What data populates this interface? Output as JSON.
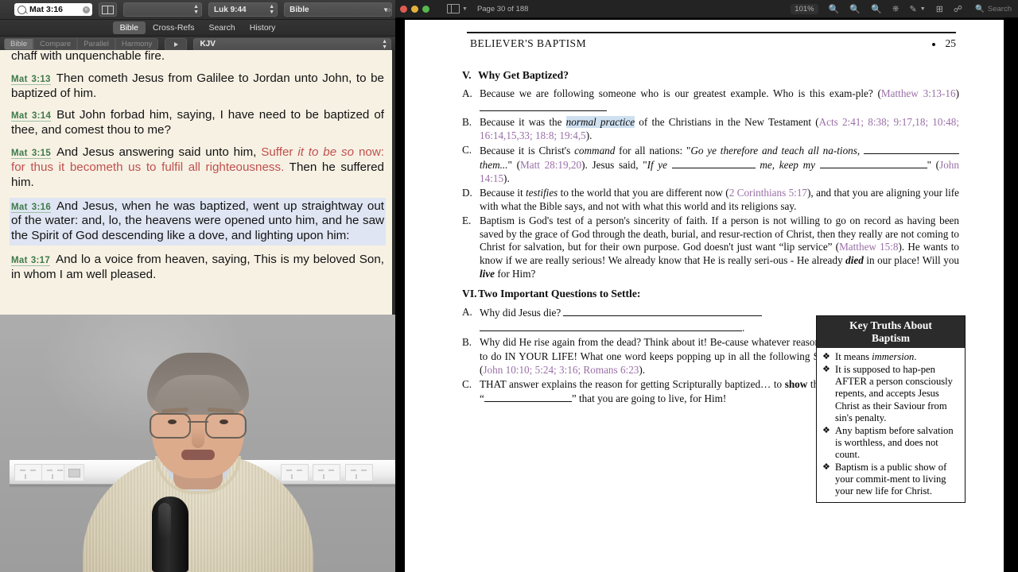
{
  "bible_app": {
    "toolbar": {
      "search_value": "Mat 3:16",
      "clear_icon": "clear-circle-icon",
      "parallel_icon": "two-pane-icon",
      "popup_blank": "",
      "popup_verse": "Luk 9:44",
      "popup_module": "Bible",
      "overflow": "»"
    },
    "tabs": [
      {
        "label": "Bible",
        "active": true
      },
      {
        "label": "Cross-Refs",
        "active": false
      },
      {
        "label": "Search",
        "active": false
      },
      {
        "label": "History",
        "active": false
      }
    ],
    "segments": [
      "Bible",
      "Compare",
      "Parallel",
      "Harmony"
    ],
    "play_label": "▶",
    "version": "KJV",
    "verses": [
      {
        "ref": "",
        "highlight": false,
        "cut_top": true,
        "parts": [
          {
            "t": "his floor, and gather his wheat into the garner; but he will burn up the chaff with unquenchable fire.",
            "s": "plain"
          }
        ]
      },
      {
        "ref": "Mat  3:13",
        "highlight": false,
        "parts": [
          {
            "t": "Then cometh Jesus from Galilee to Jordan unto John, to be baptized of him.",
            "s": "plain"
          }
        ]
      },
      {
        "ref": "Mat  3:14",
        "highlight": false,
        "parts": [
          {
            "t": "But John forbad him, saying, I have need to be baptized of thee, and comest thou to me?",
            "s": "plain"
          }
        ]
      },
      {
        "ref": "Mat 3:15",
        "highlight": false,
        "parts": [
          {
            "t": "And Jesus answering said unto him, ",
            "s": "plain"
          },
          {
            "t": "Suffer ",
            "s": "red"
          },
          {
            "t": "it to be so ",
            "s": "red-italic"
          },
          {
            "t": "now: for thus it becometh us to fulfil all righteousness.",
            "s": "red"
          },
          {
            "t": " Then he suffered him.",
            "s": "plain"
          }
        ]
      },
      {
        "ref": "Mat  3:16",
        "highlight": true,
        "parts": [
          {
            "t": "And Jesus, when he was baptized, went up straightway out of the water: and, lo, the heavens were opened unto him, and he saw the Spirit of God descending like a dove, and lighting upon him:",
            "s": "plain"
          }
        ]
      },
      {
        "ref": "Mat  3:17",
        "highlight": false,
        "parts": [
          {
            "t": "And lo a voice from heaven, saying, This is my beloved Son, in whom I am well pleased.",
            "s": "plain"
          }
        ]
      }
    ]
  },
  "pdf": {
    "toolbar": {
      "sidebar_icon": "sidebar-toggle-icon",
      "page_count": "Page 30 of 188",
      "zoom_level": "101%",
      "zoom_out_icon": "zoom-out-icon",
      "zoom_in_icon": "zoom-in-icon",
      "magnify_icon": "magnify-icon",
      "markup_icon": "markup-toolbar-icon",
      "highlight_icon": "highlight-icon",
      "highlight_chevron": "chevron-down-icon",
      "rotate_icon": "rotate-icon",
      "share_icon": "share-icon",
      "search_icon": "search-icon",
      "search_placeholder": "Search"
    },
    "page_header": {
      "running_title": "BELIEVER'S BAPTISM",
      "page_number": "25",
      "dot": "•"
    },
    "sections": [
      {
        "numeral": "V.",
        "title": "Why Get Baptized?",
        "items": [
          {
            "label": "A.",
            "runs": [
              {
                "t": "Because we are following someone who is our greatest example. Who is this exam-ple?  (",
                "s": "plain"
              },
              {
                "t": "Matthew 3:13-16",
                "s": "ref"
              },
              {
                "t": ")",
                "s": "plain"
              },
              {
                "t": "",
                "s": "blank-160"
              }
            ]
          },
          {
            "label": "B.",
            "runs": [
              {
                "t": "Because it was the ",
                "s": "plain"
              },
              {
                "t": "normal practice",
                "s": "italic-hl"
              },
              {
                "t": " of the Christians in the New Testament (",
                "s": "plain"
              },
              {
                "t": "Acts 2:41; 8:38; 9:17,18; 10:48; 16:14,15,33; 18:8; 19:4,5",
                "s": "ref"
              },
              {
                "t": ").",
                "s": "plain"
              }
            ]
          },
          {
            "label": "C.",
            "runs": [
              {
                "t": "Because it is Christ's ",
                "s": "plain"
              },
              {
                "t": "command",
                "s": "italic"
              },
              {
                "t": " for all nations: \"",
                "s": "plain"
              },
              {
                "t": "Go ye therefore and teach all na-tions, ",
                "s": "italic"
              },
              {
                "t": "",
                "s": "blank-120"
              },
              {
                "t": " ",
                "s": "plain"
              },
              {
                "t": "them...",
                "s": "italic"
              },
              {
                "t": "\" (",
                "s": "plain"
              },
              {
                "t": "Matt 28:19,20",
                "s": "ref"
              },
              {
                "t": "). Jesus said, \"",
                "s": "plain"
              },
              {
                "t": "If ye ",
                "s": "italic"
              },
              {
                "t": "",
                "s": "blank-105"
              },
              {
                "t": " ",
                "s": "plain"
              },
              {
                "t": "me, keep my ",
                "s": "italic"
              },
              {
                "t": "",
                "s": "blank-135"
              },
              {
                "t": "\" (",
                "s": "plain"
              },
              {
                "t": "John 14:15",
                "s": "ref"
              },
              {
                "t": ").",
                "s": "plain"
              }
            ]
          },
          {
            "label": "D.",
            "runs": [
              {
                "t": "Because it ",
                "s": "plain"
              },
              {
                "t": "testifies",
                "s": "italic"
              },
              {
                "t": " to the world that you are different now (",
                "s": "plain"
              },
              {
                "t": "2 Corinthians 5:17",
                "s": "ref"
              },
              {
                "t": "), and that you are aligning your life with what the Bible says, and not with what this world and its religions say.",
                "s": "plain"
              }
            ]
          },
          {
            "label": "E.",
            "runs": [
              {
                "t": "Baptism is God's test of a person's sincerity of faith. If a person is not willing to go on record as having been saved by the grace of God through the death, burial, and resur-rection of Christ, then they really are not coming to Christ for salvation, but for their own purpose. God doesn't just want “lip service” (",
                "s": "plain"
              },
              {
                "t": "Matthew 15:8",
                "s": "ref"
              },
              {
                "t": "). He wants to know if we are really serious! We already know that He is really seri-ous - He already ",
                "s": "plain"
              },
              {
                "t": "died",
                "s": "bold-italic"
              },
              {
                "t": " in our place! Will you ",
                "s": "plain"
              },
              {
                "t": "live",
                "s": "bold-italic"
              },
              {
                "t": " for Him?",
                "s": "plain"
              }
            ]
          }
        ]
      },
      {
        "numeral": "VI.",
        "title": "Two Important Questions to Settle:",
        "items": [
          {
            "label": "A.",
            "runs": [
              {
                "t": "Why  did  Jesus  die? ",
                "s": "plain"
              },
              {
                "t": "",
                "s": "blank-250"
              },
              {
                "t": "",
                "s": "blank-line2"
              }
            ]
          },
          {
            "label": "B.",
            "runs": [
              {
                "t": "Why did He rise again from the dead? Think about it! Be-cause whatever reason He did it, proves what He wants to do IN YOUR LIFE! What one word keeps popping up in all the following Scriptures? ",
                "s": "plain"
              },
              {
                "t": "",
                "s": "blank-120"
              },
              {
                "t": " (",
                "s": "plain"
              },
              {
                "t": "John 10:10; 5:24; 3:16; Romans 6:23",
                "s": "ref"
              },
              {
                "t": ").",
                "s": "plain"
              }
            ]
          },
          {
            "label": "C.",
            "runs": [
              {
                "t": "THAT answer explains the reason for getting Scripturally baptized… to ",
                "s": "plain"
              },
              {
                "t": "show",
                "s": "bold"
              },
              {
                "t": " the world that you now have a new “",
                "s": "plain"
              },
              {
                "t": "",
                "s": "blank-110"
              },
              {
                "t": "” that you are going to live, for Him!",
                "s": "plain"
              }
            ]
          }
        ]
      }
    ],
    "key_box": {
      "title_line1": "Key Truths About",
      "title_line2": "Baptism",
      "bullet": "❖",
      "items": [
        [
          {
            "t": "It means ",
            "s": "plain"
          },
          {
            "t": "immersion",
            "s": "italic"
          },
          {
            "t": ".",
            "s": "plain"
          }
        ],
        [
          {
            "t": "It is supposed to hap-pen AFTER a person consciously repents, and accepts Jesus Christ as their Saviour from sin's penalty.",
            "s": "plain"
          }
        ],
        [
          {
            "t": "Any baptism before salvation is worthless, and does not count.",
            "s": "plain"
          }
        ],
        [
          {
            "t": "Baptism is a public show of your commit-ment to living your new life for Christ.",
            "s": "plain"
          }
        ]
      ]
    }
  },
  "webcam": {
    "label": "speaker-video-feed"
  },
  "colors": {
    "verse_ref": "#3d7a49",
    "words_of_jesus": "#c0504d",
    "scripture_ref": "#9a6fa8",
    "highlight": "#dfe5f2",
    "paper": "#f7f1e4"
  }
}
